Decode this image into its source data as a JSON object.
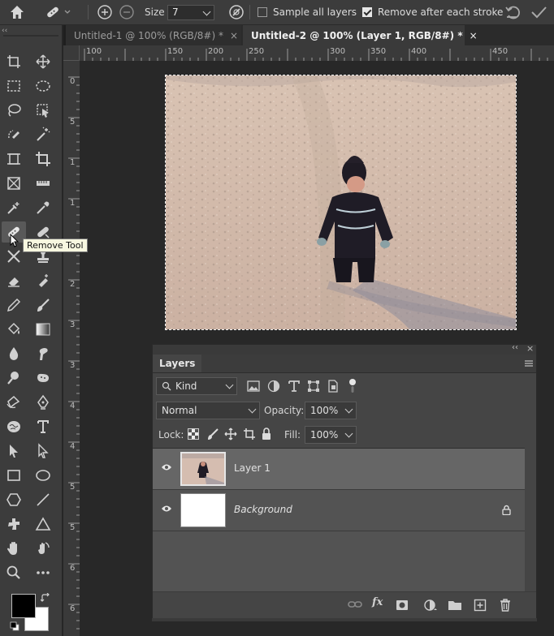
{
  "options_bar": {
    "size_label": "Size",
    "size_value": "7",
    "sample_all_layers_label": "Sample all layers",
    "sample_all_layers_checked": false,
    "remove_after_stroke_label": "Remove after each stroke",
    "remove_after_stroke_checked": true
  },
  "tabs": [
    {
      "label": "Untitled-1 @ 100% (RGB/8#) *",
      "close": "×",
      "active": false
    },
    {
      "label": "Untitled-2 @ 100% (Layer 1, RGB/8#) *",
      "close": "×",
      "active": true
    }
  ],
  "ruler": {
    "h_labels": [
      "100",
      "150",
      "200",
      "250",
      "300",
      "350",
      "400",
      "450"
    ],
    "v_labels": [
      "0",
      "5",
      "1",
      "1",
      "2",
      "2",
      "3",
      "3",
      "4",
      "4",
      "5",
      "5",
      "6",
      "6",
      "7",
      "7"
    ]
  },
  "tooltip": "Remove Tool",
  "layers_panel": {
    "title": "Layers",
    "filter_kind": "Kind",
    "blend_mode": "Normal",
    "opacity_label": "Opacity:",
    "opacity_value": "100%",
    "lock_label": "Lock:",
    "fill_label": "Fill:",
    "fill_value": "100%",
    "layers": [
      {
        "name": "Layer 1",
        "selected": true,
        "locked": false
      },
      {
        "name": "Background",
        "selected": false,
        "locked": true
      }
    ],
    "footer_fx": "fx"
  },
  "colors": {
    "foreground": "#000000",
    "background": "#ffffff",
    "accent": "#1473e6"
  }
}
